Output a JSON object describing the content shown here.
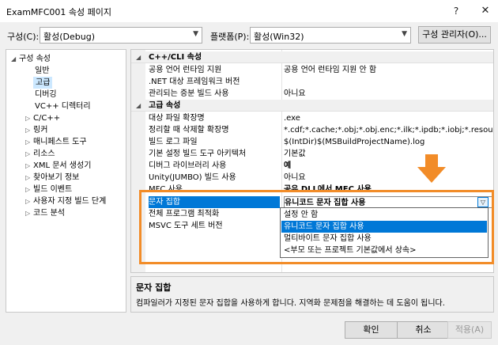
{
  "window": {
    "title": "ExamMFC001 속성 페이지",
    "help_glyph": "?",
    "close_glyph": "✕"
  },
  "config": {
    "configuration_label": "구성(C):",
    "configuration_value": "활성(Debug)",
    "platform_label": "플랫폼(P):",
    "platform_value": "활성(Win32)",
    "manager_button": "구성 관리자(O)..."
  },
  "tree": {
    "items": [
      {
        "label": "구성 속성",
        "expander": "◢"
      },
      {
        "label": "일반",
        "expander": ""
      },
      {
        "label": "고급",
        "expander": ""
      },
      {
        "label": "디버깅",
        "expander": ""
      },
      {
        "label": "VC++ 디렉터리",
        "expander": ""
      },
      {
        "label": "C/C++",
        "expander": "▷"
      },
      {
        "label": "링커",
        "expander": "▷"
      },
      {
        "label": "매니페스트 도구",
        "expander": "▷"
      },
      {
        "label": "리소스",
        "expander": "▷"
      },
      {
        "label": "XML 문서 생성기",
        "expander": "▷"
      },
      {
        "label": "찾아보기 정보",
        "expander": "▷"
      },
      {
        "label": "빌드 이벤트",
        "expander": "▷"
      },
      {
        "label": "사용자 지정 빌드 단계",
        "expander": "▷"
      },
      {
        "label": "코드 분석",
        "expander": "▷"
      }
    ]
  },
  "grid": {
    "rows": [
      {
        "name": "C++/CLI 속성",
        "value": "",
        "expander": "◢"
      },
      {
        "name": "공용 언어 런타임 지원",
        "value": "공용 언어 런타임 지원 안 함"
      },
      {
        "name": ".NET 대상 프레임워크 버전",
        "value": ""
      },
      {
        "name": "관리되는 증분 빌드 사용",
        "value": "아니요"
      },
      {
        "name": "고급 속성",
        "value": "",
        "expander": "◢"
      },
      {
        "name": "대상 파일 확장명",
        "value": ".exe"
      },
      {
        "name": "정리할 때 삭제할 확장명",
        "value": "*.cdf;*.cache;*.obj;*.obj.enc;*.ilk;*.ipdb;*.iobj;*.resources;*.tlb;*.tli;*.tlh;"
      },
      {
        "name": "빌드 로그 파일",
        "value": "$(IntDir)$(MSBuildProjectName).log"
      },
      {
        "name": "기본 설정 빌드 도구 아키텍처",
        "value": "기본값"
      },
      {
        "name": "디버그 라이브러리 사용",
        "value": "예"
      },
      {
        "name": "Unity(JUMBO) 빌드 사용",
        "value": "아니요"
      },
      {
        "name": "MFC 사용",
        "value": "공유 DLL에서 MFC 사용"
      },
      {
        "name": "문자 집합",
        "value": "유니코드 문자 집합 사용"
      },
      {
        "name": "전체 프로그램 최적화",
        "value": ""
      },
      {
        "name": "MSVC 도구 세트 버전",
        "value": ""
      }
    ]
  },
  "dropdown": {
    "options": [
      "설정 안 함",
      "유니코드 문자 집합 사용",
      "멀티바이트 문자 집합 사용",
      "<부모 또는 프로젝트 기본값에서 상속>"
    ],
    "selected_index": 1,
    "button_glyph": "▽"
  },
  "description": {
    "title": "문자 집합",
    "text": "컴파일러가 지정된 문자 집합을 사용하게 합니다. 지역화 문제점을 해결하는 데 도움이 됩니다."
  },
  "buttons": {
    "ok": "확인",
    "cancel": "취소",
    "apply": "적용(A)"
  },
  "colors": {
    "annotation": "#f28c28",
    "selection": "#0078d7"
  }
}
